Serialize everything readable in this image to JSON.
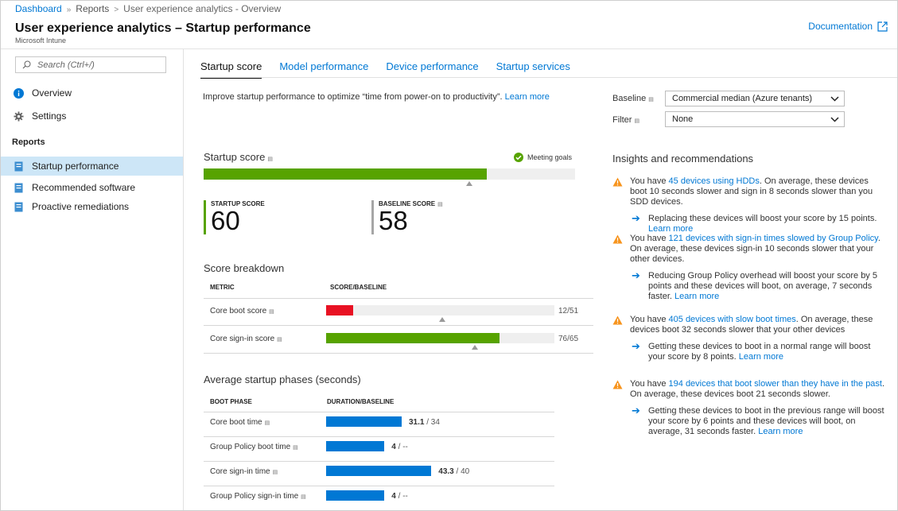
{
  "breadcrumb": {
    "items": [
      "Dashboard",
      "Reports",
      "User experience analytics - Overview"
    ],
    "separators": [
      "»",
      ">"
    ]
  },
  "header": {
    "title": "User experience analytics – Startup performance",
    "subtitle": "Microsoft Intune",
    "documentation_link": "Documentation"
  },
  "sidebar": {
    "search_placeholder": "Search (Ctrl+/)",
    "items": [
      {
        "label": "Overview",
        "icon": "info-icon"
      },
      {
        "label": "Settings",
        "icon": "gear-icon"
      }
    ],
    "reports_heading": "Reports",
    "reports": [
      {
        "label": "Startup performance",
        "icon": "report-icon",
        "active": true
      },
      {
        "label": "Recommended software",
        "icon": "report-icon"
      },
      {
        "label": "Proactive remediations",
        "icon": "report-icon"
      }
    ]
  },
  "tabs": [
    {
      "label": "Startup score",
      "active": true
    },
    {
      "label": "Model performance"
    },
    {
      "label": "Device performance"
    },
    {
      "label": "Startup services"
    }
  ],
  "intro": {
    "text": "Improve startup performance to optimize “time from power-on to productivity”.",
    "link": "Learn more"
  },
  "filters": {
    "baseline_label": "Baseline",
    "baseline_value": "Commercial median (Azure tenants)",
    "filter_label": "Filter",
    "filter_value": "None"
  },
  "startup_score": {
    "title": "Startup score",
    "status": "Meeting goals",
    "score_fraction": 0.763,
    "baseline_fraction": 0.715,
    "startup_label": "STARTUP SCORE",
    "startup_value": "60",
    "baseline_label": "BASELINE SCORE",
    "baseline_value": "58",
    "colors": {
      "good": "#57a300",
      "baseline_bar": "#a6a6a6"
    }
  },
  "breakdown": {
    "title": "Score breakdown",
    "col_metric": "METRIC",
    "col_score": "SCORE/BASELINE",
    "rows": [
      {
        "label": "Core boot score",
        "text": "12/51",
        "score": 12,
        "baseline": 51,
        "max": 100,
        "color": "#e81123"
      },
      {
        "label": "Core sign-in score",
        "text": "76/65",
        "score": 76,
        "baseline": 65,
        "max": 100,
        "color": "#57a300"
      }
    ]
  },
  "phases": {
    "title": "Average startup phases (seconds)",
    "col_phase": "BOOT PHASE",
    "col_duration": "DURATION/BASELINE",
    "rows": [
      {
        "label": "Core boot time",
        "value": "31.1",
        "baseline": " / 34",
        "seconds": 31.1
      },
      {
        "label": "Group Policy boot time",
        "value": "4",
        "baseline": " / --",
        "seconds": 24
      },
      {
        "label": "Core sign-in time",
        "value": "43.3",
        "baseline": " / 40",
        "seconds": 43.3
      },
      {
        "label": "Group Policy sign-in time",
        "value": "4",
        "baseline": " / --",
        "seconds": 24
      }
    ],
    "bar_color": "#0078d4"
  },
  "insights": {
    "title": "Insights and recommendations",
    "items": [
      {
        "pre": "You have ",
        "link": "45 devices using HDDs",
        "post": ". On average, these devices boot 10 seconds slower and sign in 8 seconds slower than you SDD devices.",
        "rec": "Replacing these devices will boost your score by 15 points. ",
        "rec_link": "Learn more"
      },
      {
        "pre": "You have ",
        "link": "121 devices with sign-in times slowed by Group Policy",
        "post": ". On average, these devices sign-in 10 seconds slower that your other devices.",
        "rec": "Reducing Group Policy overhead will boost your score by 5 points and these devices will boot, on average, 7 seconds faster. ",
        "rec_link": "Learn more"
      },
      {
        "pre": "You have ",
        "link": "405 devices with slow boot times",
        "post": ". On average, these devices boot 32 seconds slower that your other devices",
        "rec": "Getting these devices to boot in a normal range will boost your score by 8 points. ",
        "rec_link": "Learn more"
      },
      {
        "pre": "You have ",
        "link": "194 devices that boot slower than they have in the past",
        "post": ". On average, these devices boot 21 seconds slower.",
        "rec": "Getting these devices to boot in the previous range will boost your score by 6 points and these devices will boot, on average, 31 seconds faster. ",
        "rec_link": "Learn more"
      }
    ],
    "warn_color": "#f7941d"
  }
}
